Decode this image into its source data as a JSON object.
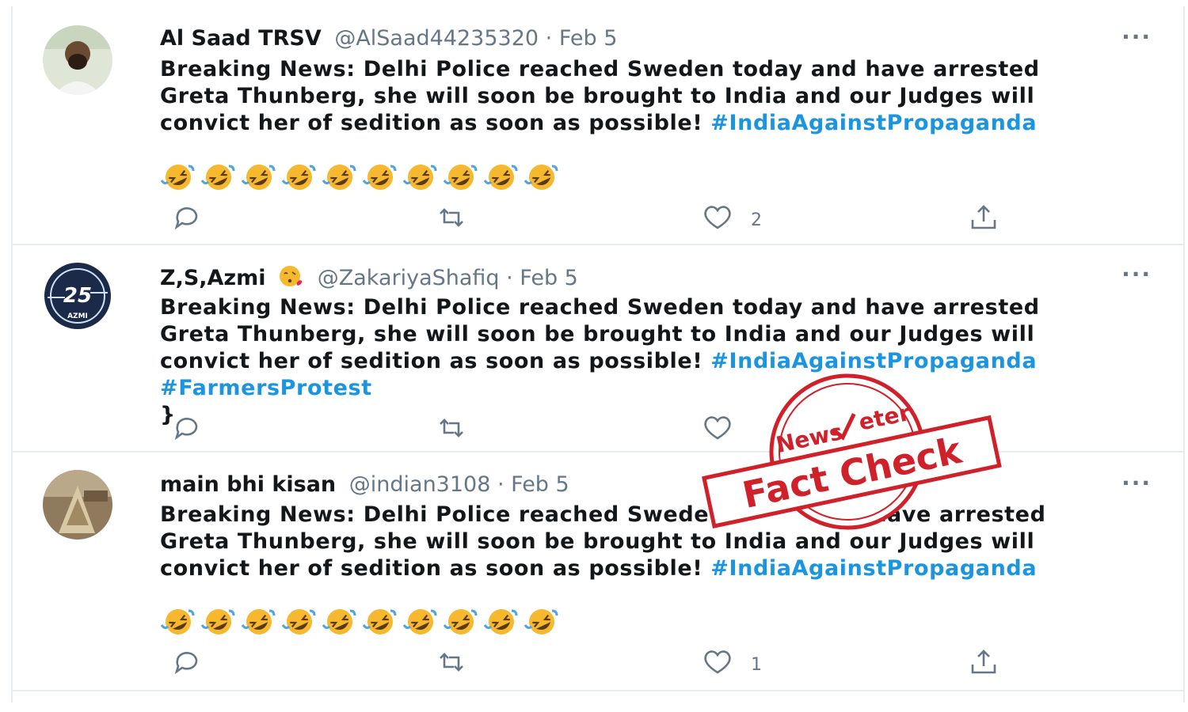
{
  "tweets": [
    {
      "name": "Al Saad TRSV",
      "handle": "@AlSaad44235320 · Feb 5",
      "lines": [
        "Breaking News: Delhi Police reached Sweden today  and have arrested",
        "Greta Thunberg, she will soon be brought to India and  our Judges will",
        "convict her of sedition as soon as possible!"
      ],
      "hashtag": "#IndiaAgainstPropaganda",
      "hashtag2": "",
      "emoji_count": 10,
      "likes": "2",
      "more": "···"
    },
    {
      "name": "Z,S,Azmi",
      "handle": "@ZakariyaShafiq · Feb 5",
      "lines": [
        "Breaking News: Delhi Police reached Sweden today  and have arrested",
        "Greta Thunberg, she will soon be brought to India and  our Judges will",
        "convict her of sedition as soon as possible!"
      ],
      "hashtag": "#IndiaAgainstPropaganda",
      "hashtag2": "#FarmersProtest",
      "emoji_count": 0,
      "likes": "",
      "more": "···",
      "avatar_text": "25",
      "avatar_label": "AZMI"
    },
    {
      "name": "main bhi kisan",
      "handle": "@indian3108 · Feb 5",
      "lines": [
        "Breaking News: Delhi Police reached Swede",
        "Greta Thunberg, she will soon be brought to India and  our Judges will",
        "convict her of sedition as soon as possible!"
      ],
      "line1_tail": "have arrested",
      "hashtag": "#IndiaAgainstPropaganda",
      "hashtag2": "",
      "emoji_count": 10,
      "likes": "1",
      "more": "···"
    }
  ],
  "stamp": {
    "top_text": "News",
    "brand_text": "eter",
    "main_text": "Fact Check",
    "color": "#d0202a"
  },
  "colors": {
    "hashtag": "#1b95e0",
    "text": "#14171a",
    "secondary": "#657786",
    "border": "#e6ecf0"
  },
  "icons": [
    "reply-icon",
    "retweet-icon",
    "like-icon",
    "share-icon",
    "more-icon",
    "rofl-emoji"
  ]
}
